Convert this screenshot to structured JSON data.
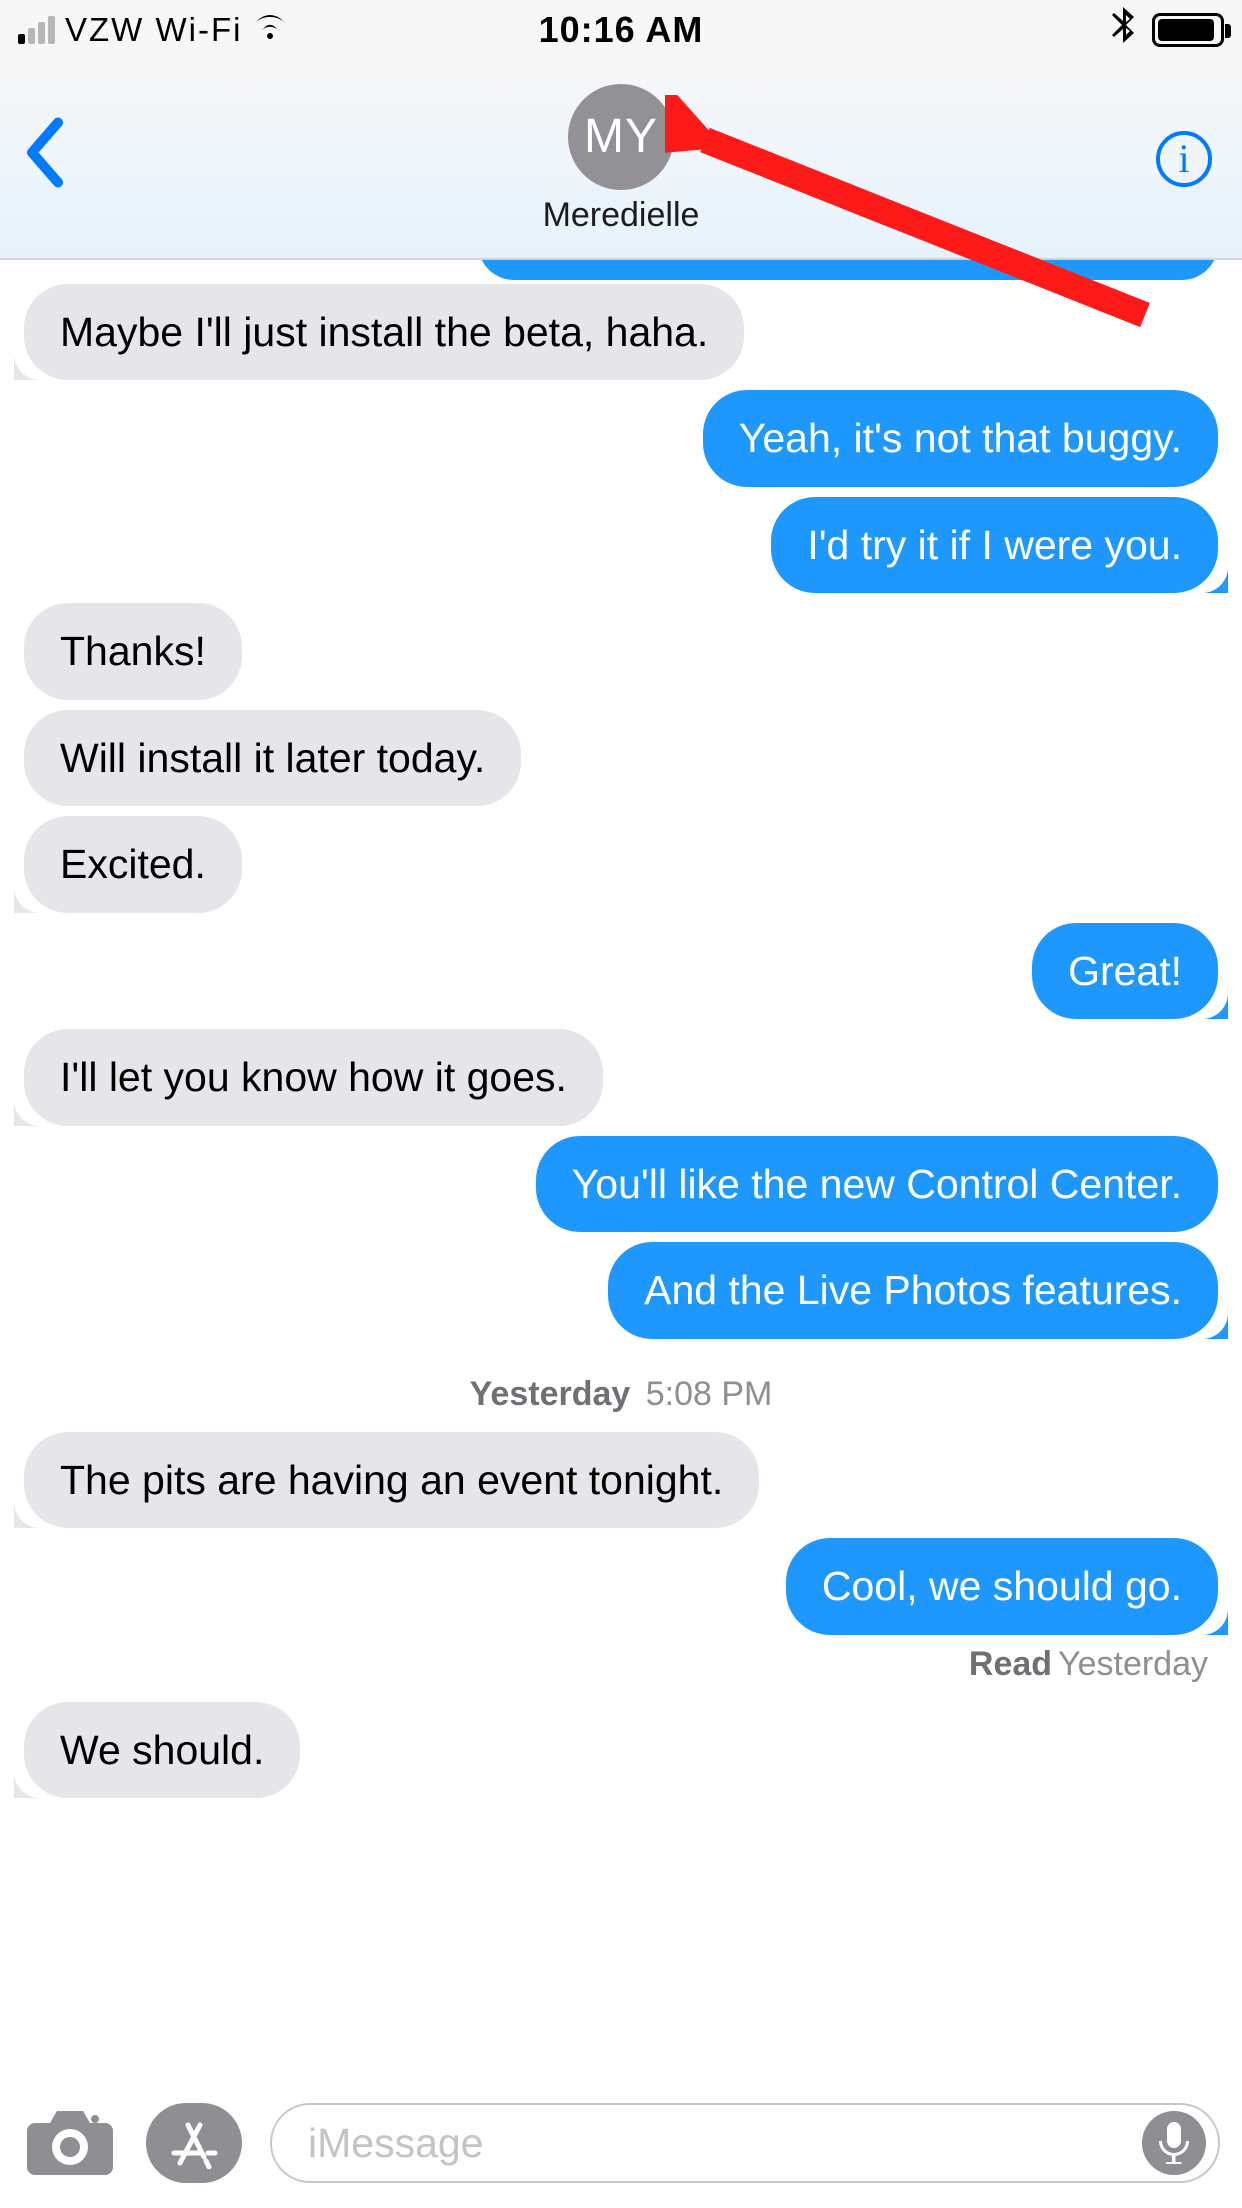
{
  "status": {
    "carrier": "VZW Wi-Fi",
    "time": "10:16 AM"
  },
  "header": {
    "contact_initials": "MY",
    "contact_name": "Meredielle"
  },
  "thread": {
    "messages": [
      {
        "dir": "in",
        "text": "Maybe I'll just install the beta, haha.",
        "tail": true
      },
      {
        "dir": "out",
        "text": "Yeah, it's not that buggy.",
        "tail": false
      },
      {
        "dir": "out",
        "text": "I'd try it if I were you.",
        "tail": true
      },
      {
        "dir": "in",
        "text": "Thanks!",
        "tail": false
      },
      {
        "dir": "in",
        "text": "Will install it later today.",
        "tail": false
      },
      {
        "dir": "in",
        "text": "Excited.",
        "tail": true
      },
      {
        "dir": "out",
        "text": "Great!",
        "tail": true
      },
      {
        "dir": "in",
        "text": "I'll let you know how it goes.",
        "tail": true
      },
      {
        "dir": "out",
        "text": "You'll like the new Control Center.",
        "tail": false
      },
      {
        "dir": "out",
        "text": "And the Live Photos features.",
        "tail": true
      }
    ],
    "timestamp": {
      "day": "Yesterday",
      "time": "5:08 PM"
    },
    "after_ts": [
      {
        "dir": "in",
        "text": "The pits are having an event tonight.",
        "tail": true
      },
      {
        "dir": "out",
        "text": "Cool, we should go.",
        "tail": true
      }
    ],
    "receipt": {
      "state": "Read",
      "when": "Yesterday"
    },
    "after_receipt": [
      {
        "dir": "in",
        "text": "We should.",
        "tail": true
      }
    ]
  },
  "input": {
    "placeholder": "iMessage"
  }
}
